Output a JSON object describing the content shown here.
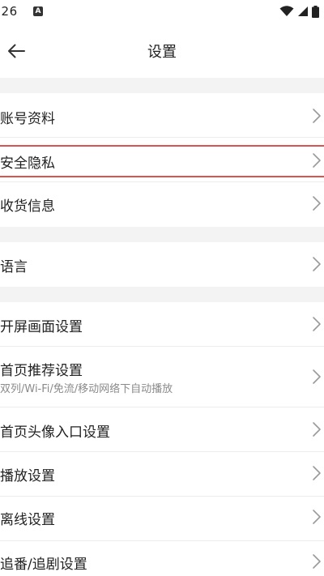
{
  "status_bar": {
    "time": ":26",
    "notification_badge": "A"
  },
  "header": {
    "title": "设置"
  },
  "groups": [
    {
      "items": [
        {
          "label": "账号资料"
        },
        {
          "label": "安全隐私"
        },
        {
          "label": "收货信息"
        }
      ]
    },
    {
      "items": [
        {
          "label": "语言"
        }
      ]
    },
    {
      "items": [
        {
          "label": "开屏画面设置"
        },
        {
          "label": "首页推荐设置",
          "sub": "双列/Wi-Fi/免流/移动网络下自动播放"
        },
        {
          "label": "首页头像入口设置"
        },
        {
          "label": "播放设置"
        },
        {
          "label": "离线设置"
        },
        {
          "label": "追番/追剧设置"
        }
      ]
    }
  ],
  "colors": {
    "highlight": "#d9534f",
    "divider_gap": "#f3f3f3",
    "subtext": "#8a8a8a"
  }
}
